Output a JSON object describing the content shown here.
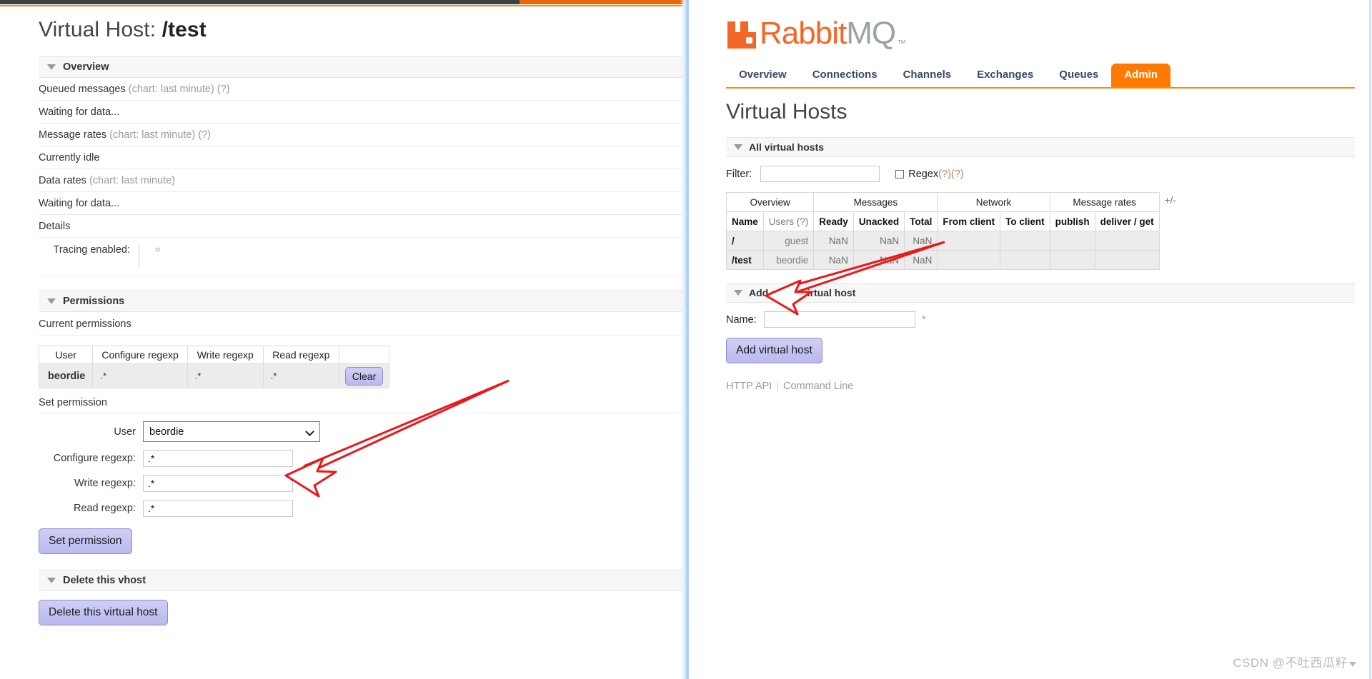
{
  "left": {
    "page_title_prefix": "Virtual Host: ",
    "page_title_value": "/test",
    "overview": {
      "heading": "Overview",
      "queued_messages_label": "Queued messages",
      "queued_messages_note": "(chart: last minute) (?)",
      "queued_messages_status": "Waiting for data...",
      "message_rates_label": "Message rates",
      "message_rates_note": "(chart: last minute) (?)",
      "message_rates_status": "Currently idle",
      "data_rates_label": "Data rates",
      "data_rates_note": "(chart: last minute)",
      "data_rates_status": "Waiting for data...",
      "details_label": "Details",
      "tracing_label": "Tracing enabled:",
      "tracing_value": "○"
    },
    "permissions": {
      "heading": "Permissions",
      "current_label": "Current permissions",
      "columns": [
        "User",
        "Configure regexp",
        "Write regexp",
        "Read regexp",
        ""
      ],
      "rows": [
        {
          "user": "beordie",
          "configure": ".*",
          "write": ".*",
          "read": ".*",
          "action": "Clear"
        }
      ],
      "set_label": "Set permission",
      "user_field_label": "User",
      "user_field_value": "beordie",
      "configure_field_label": "Configure regexp:",
      "configure_field_value": ".*",
      "write_field_label": "Write regexp:",
      "write_field_value": ".*",
      "read_field_label": "Read regexp:",
      "read_field_value": ".*",
      "submit_label": "Set permission"
    },
    "delete": {
      "heading": "Delete this vhost",
      "button_label": "Delete this virtual host"
    }
  },
  "right": {
    "logo": {
      "word_orange": "Rabbit",
      "word_gray": "MQ",
      "tm": "™"
    },
    "tabs": [
      {
        "label": "Overview",
        "active": false
      },
      {
        "label": "Connections",
        "active": false
      },
      {
        "label": "Channels",
        "active": false
      },
      {
        "label": "Exchanges",
        "active": false
      },
      {
        "label": "Queues",
        "active": false
      },
      {
        "label": "Admin",
        "active": true
      }
    ],
    "title": "Virtual Hosts",
    "all_vhosts": {
      "heading": "All virtual hosts",
      "filter_label": "Filter:",
      "filter_value": "",
      "regex_label": "Regex",
      "regex_help": "(?)(?)",
      "group_headers": [
        "Overview",
        "Messages",
        "Network",
        "Message rates"
      ],
      "plus_minus": "+/-",
      "sub_headers": [
        "Name",
        "Users (?)",
        "Ready",
        "Unacked",
        "Total",
        "From client",
        "To client",
        "publish",
        "deliver / get"
      ],
      "rows": [
        {
          "name": "/",
          "users": "guest",
          "ready": "NaN",
          "unacked": "NaN",
          "total": "NaN",
          "from_client": "",
          "to_client": "",
          "publish": "",
          "deliver_get": ""
        },
        {
          "name": "/test",
          "users": "beordie",
          "ready": "NaN",
          "unacked": "NaN",
          "total": "NaN",
          "from_client": "",
          "to_client": "",
          "publish": "",
          "deliver_get": ""
        }
      ]
    },
    "add_vhost": {
      "heading": "Add a new virtual host",
      "name_label": "Name:",
      "name_value": "",
      "required_mark": "*",
      "button_label": "Add virtual host"
    },
    "footer": {
      "http_api": "HTTP API",
      "command_line": "Command Line"
    }
  },
  "watermark": "CSDN @不吐西瓜籽",
  "colors": {
    "brand_orange": "#f26725",
    "tab_active": "#ff7a00",
    "rule_orange": "#f29100",
    "annotation_red": "#e8191b",
    "button_purple": "#b9b9ee"
  }
}
